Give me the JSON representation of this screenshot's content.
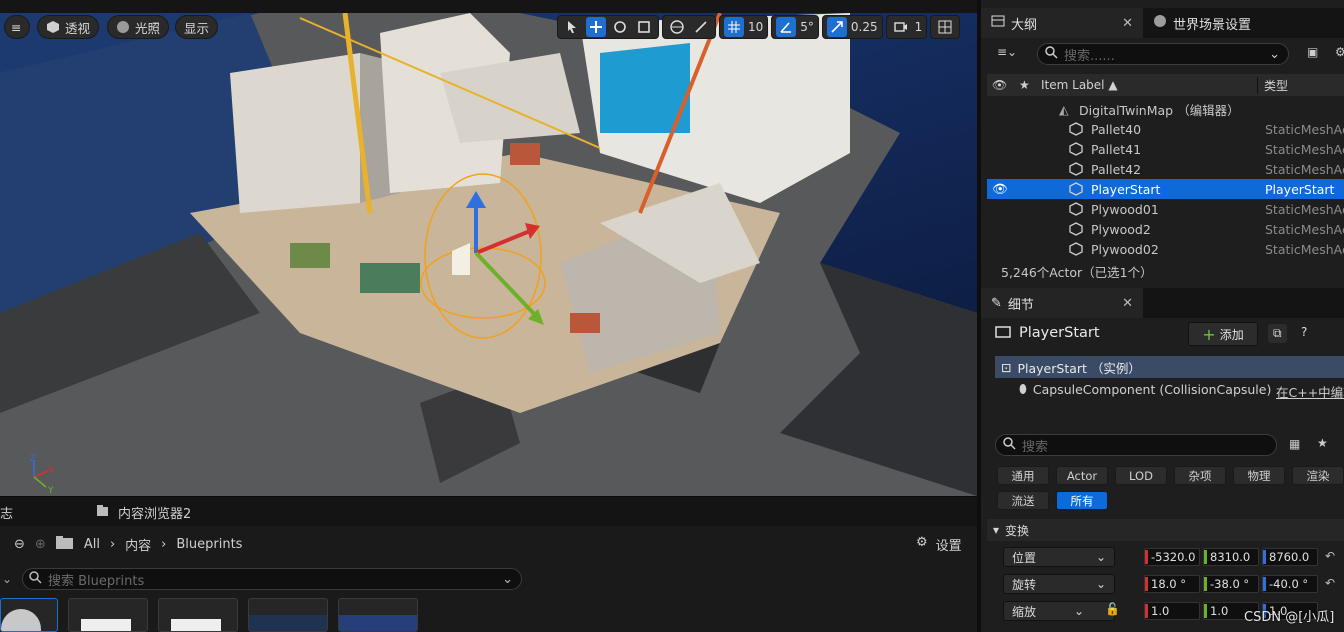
{
  "viewport": {
    "buttons": {
      "menu": "≡",
      "perspective": "透视",
      "lit": "光照",
      "show": "显示"
    },
    "grid_snap": "10",
    "rot_snap": "5°",
    "scale_snap": "0.25",
    "camera_speed": "1",
    "axis": {
      "x": "X",
      "y": "Y",
      "z": "Z"
    }
  },
  "content_browser": {
    "log_tab": "志",
    "tab": "内容浏览器2",
    "path": [
      "All",
      "内容",
      "Blueprints"
    ],
    "settings": "设置",
    "search_placeholder": "搜索 Blueprints"
  },
  "outliner": {
    "tab": "大纲",
    "world_tab": "世界场景设置",
    "search_placeholder": "搜索......",
    "col_label": "Item Label ▲",
    "col_type": "类型",
    "map": "DigitalTwinMap （编辑器）",
    "rows": [
      {
        "name": "Pallet40",
        "type": "StaticMeshActor"
      },
      {
        "name": "Pallet41",
        "type": "StaticMeshActor"
      },
      {
        "name": "Pallet42",
        "type": "StaticMeshActor"
      },
      {
        "name": "PlayerStart",
        "type": "PlayerStart"
      },
      {
        "name": "Plywood01",
        "type": "StaticMeshActor"
      },
      {
        "name": "Plywood2",
        "type": "StaticMeshActor"
      },
      {
        "name": "Plywood02",
        "type": "StaticMeshActor"
      }
    ],
    "status": "5,246个Actor（已选1个）"
  },
  "details": {
    "tab": "细节",
    "actor": "PlayerStart",
    "add": "添加",
    "instance": "PlayerStart （实例）",
    "component": "CapsuleComponent (CollisionCapsule)",
    "cpp": "在C++中编辑",
    "search_placeholder": "搜索",
    "filters": [
      "通用",
      "Actor",
      "LOD",
      "杂项",
      "物理",
      "渲染",
      "流送",
      "所有"
    ],
    "section": "变换",
    "location": {
      "label": "位置",
      "x": "-5320.0",
      "y": "8310.0",
      "z": "8760.0"
    },
    "rotation": {
      "label": "旋转",
      "x": "18.0 °",
      "y": "-38.0 °",
      "z": "-40.0 °"
    },
    "scale": {
      "label": "缩放",
      "x": "1.0",
      "y": "1.0",
      "z": "1.0"
    }
  },
  "watermark": "CSDN @[小瓜]",
  "colors": {
    "accent": "#0d6ad8",
    "x": "#d53030",
    "y": "#6fb02b",
    "z": "#2f6fe0"
  }
}
